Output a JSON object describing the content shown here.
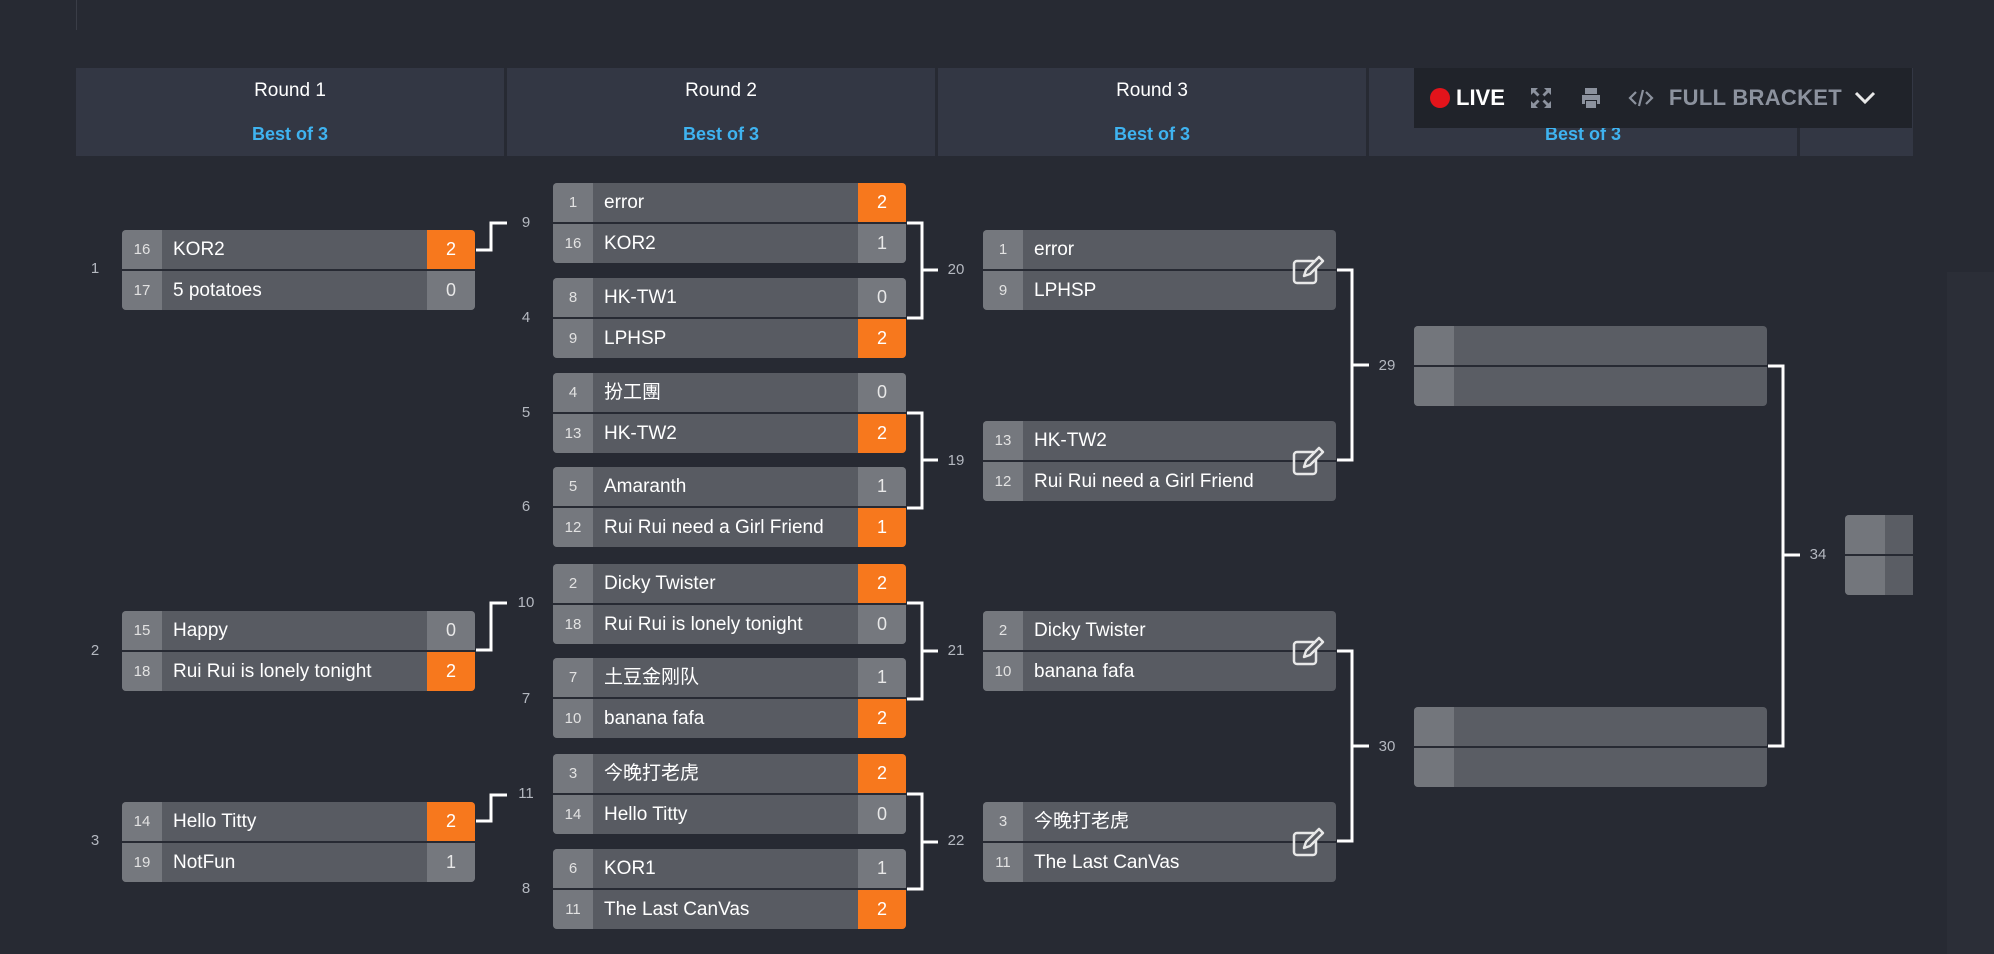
{
  "rounds": [
    {
      "name": "Round 1",
      "best_of": "Best of 3"
    },
    {
      "name": "Round 2",
      "best_of": "Best of 3"
    },
    {
      "name": "Round 3",
      "best_of": "Best of 3"
    },
    {
      "name": "",
      "best_of": "Best of 3"
    },
    {
      "name": "",
      "best_of": ""
    }
  ],
  "toolbar": {
    "live_label": "LIVE",
    "full_bracket_label": "FULL BRACKET",
    "live_color": "#e3141b"
  },
  "accent_colors": {
    "winner_score": "#f7781d",
    "best_of_text": "#3fb3f0"
  },
  "round1": [
    {
      "num": "1",
      "teams": [
        {
          "seed": "16",
          "name": "KOR2",
          "score": "2",
          "win": true
        },
        {
          "seed": "17",
          "name": "5 potatoes",
          "score": "0",
          "win": false
        }
      ]
    },
    {
      "num": "2",
      "teams": [
        {
          "seed": "15",
          "name": "Happy",
          "score": "0",
          "win": false
        },
        {
          "seed": "18",
          "name": "Rui Rui is lonely tonight",
          "score": "2",
          "win": true
        }
      ]
    },
    {
      "num": "3",
      "teams": [
        {
          "seed": "14",
          "name": "Hello Titty",
          "score": "2",
          "win": true
        },
        {
          "seed": "19",
          "name": "NotFun",
          "score": "1",
          "win": false
        }
      ]
    }
  ],
  "round2": [
    {
      "num": "9",
      "teams": [
        {
          "seed": "1",
          "name": "error",
          "score": "2",
          "win": true
        },
        {
          "seed": "16",
          "name": "KOR2",
          "score": "1",
          "win": false
        }
      ]
    },
    {
      "num": "4",
      "teams": [
        {
          "seed": "8",
          "name": "HK-TW1",
          "score": "0",
          "win": false
        },
        {
          "seed": "9",
          "name": "LPHSP",
          "score": "2",
          "win": true
        }
      ]
    },
    {
      "num": "5",
      "teams": [
        {
          "seed": "4",
          "name": "扮工團",
          "score": "0",
          "win": false
        },
        {
          "seed": "13",
          "name": "HK-TW2",
          "score": "2",
          "win": true
        }
      ]
    },
    {
      "num": "6",
      "teams": [
        {
          "seed": "5",
          "name": "Amaranth",
          "score": "1",
          "win": false
        },
        {
          "seed": "12",
          "name": "Rui Rui need a Girl Friend",
          "score": "1",
          "win": true
        }
      ]
    },
    {
      "num": "10",
      "teams": [
        {
          "seed": "2",
          "name": "Dicky Twister",
          "score": "2",
          "win": true
        },
        {
          "seed": "18",
          "name": "Rui Rui is lonely tonight",
          "score": "0",
          "win": false
        }
      ]
    },
    {
      "num": "7",
      "teams": [
        {
          "seed": "7",
          "name": "土豆金刚队",
          "score": "1",
          "win": false
        },
        {
          "seed": "10",
          "name": "banana fafa",
          "score": "2",
          "win": true
        }
      ]
    },
    {
      "num": "11",
      "teams": [
        {
          "seed": "3",
          "name": "今晚打老虎",
          "score": "2",
          "win": true
        },
        {
          "seed": "14",
          "name": "Hello Titty",
          "score": "0",
          "win": false
        }
      ]
    },
    {
      "num": "8",
      "teams": [
        {
          "seed": "6",
          "name": "KOR1",
          "score": "1",
          "win": false
        },
        {
          "seed": "11",
          "name": "The Last CanVas",
          "score": "2",
          "win": true
        }
      ]
    }
  ],
  "round3": [
    {
      "num": "20",
      "teams": [
        {
          "seed": "1",
          "name": "error"
        },
        {
          "seed": "9",
          "name": "LPHSP"
        }
      ]
    },
    {
      "num": "19",
      "teams": [
        {
          "seed": "13",
          "name": "HK-TW2"
        },
        {
          "seed": "12",
          "name": "Rui Rui need a Girl Friend"
        }
      ]
    },
    {
      "num": "21",
      "teams": [
        {
          "seed": "2",
          "name": "Dicky Twister"
        },
        {
          "seed": "10",
          "name": "banana fafa"
        }
      ]
    },
    {
      "num": "22",
      "teams": [
        {
          "seed": "3",
          "name": "今晚打老虎"
        },
        {
          "seed": "11",
          "name": "The Last CanVas"
        }
      ]
    }
  ],
  "round4": [
    {
      "num": "29"
    },
    {
      "num": "30"
    }
  ],
  "round5": [
    {
      "num": "34"
    }
  ]
}
